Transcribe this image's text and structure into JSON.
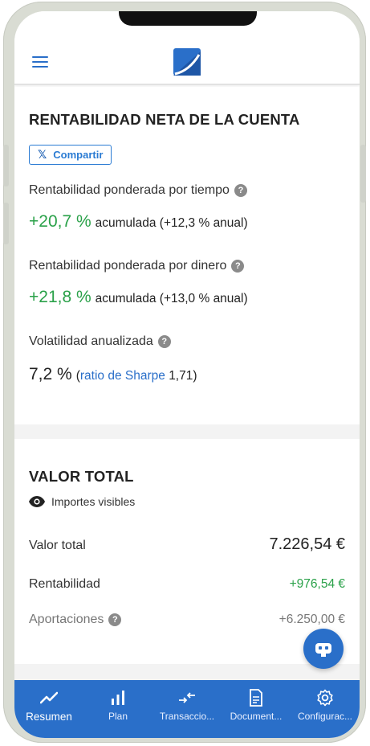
{
  "returns": {
    "title": "RENTABILIDAD NETA DE LA CUENTA",
    "share_label": "Compartir",
    "twr_label": "Rentabilidad ponderada por tiempo",
    "twr_value": "+20,7 %",
    "twr_suffix": "acumulada (+12,3 % anual)",
    "mwr_label": "Rentabilidad ponderada por dinero",
    "mwr_value": "+21,8 %",
    "mwr_suffix": "acumulada (+13,0 % anual)",
    "vol_label": "Volatilidad anualizada",
    "vol_value": "7,2 %",
    "sharpe_open": "(",
    "sharpe_link": "ratio de Sharpe",
    "sharpe_value": "1,71)"
  },
  "total_value": {
    "title": "VALOR TOTAL",
    "visibility_label": "Importes visibles",
    "rows": [
      {
        "label": "Valor total",
        "amount": "7.226,54 €"
      },
      {
        "label": "Rentabilidad",
        "amount": "+976,54 €"
      },
      {
        "label": "Aportaciones",
        "amount": "+6.250,00 €"
      }
    ]
  },
  "bottom_nav": [
    {
      "label": "Resumen",
      "icon": "trend-icon",
      "active": true
    },
    {
      "label": "Plan",
      "icon": "bar-chart-icon"
    },
    {
      "label": "Transaccio...",
      "icon": "transfer-icon"
    },
    {
      "label": "Document...",
      "icon": "document-icon"
    },
    {
      "label": "Configurac...",
      "icon": "gear-icon"
    }
  ],
  "colors": {
    "accent": "#2a6fc9",
    "positive": "#2aa149",
    "muted": "#777777"
  }
}
